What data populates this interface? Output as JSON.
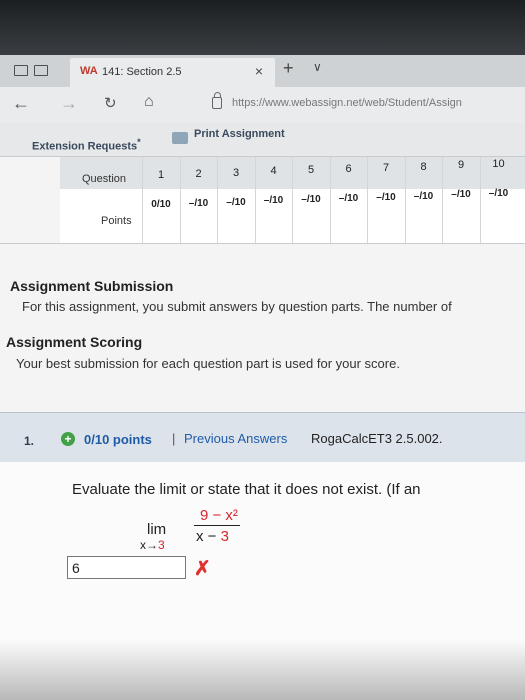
{
  "browser": {
    "tab_title": "141: Section 2.5",
    "tab_favicon": "WA",
    "tab_close": "×",
    "new_tab": "+",
    "tab_list": "∨",
    "url": "https://www.webassign.net/web/Student/Assign",
    "back": "←",
    "forward": "→",
    "refresh": "↻",
    "home": "⌂"
  },
  "toolbar": {
    "extension_requests": "Extension Requests",
    "extension_marker": "*",
    "print_assignment": "Print Assignment"
  },
  "score_grid": {
    "question_label": "Question",
    "points_label": "Points",
    "questions": [
      "1",
      "2",
      "3",
      "4",
      "5",
      "6",
      "7",
      "8",
      "9",
      "10"
    ],
    "scores": [
      "0/10",
      "–/10",
      "–/10",
      "–/10",
      "–/10",
      "–/10",
      "–/10",
      "–/10",
      "–/10",
      "–/10"
    ]
  },
  "submission": {
    "title": "Assignment Submission",
    "text": "For this assignment, you submit answers by question parts. The number of"
  },
  "scoring": {
    "title": "Assignment Scoring",
    "text": "Your best submission for each question part is used for your score."
  },
  "question": {
    "number": "1.",
    "plus": "+",
    "points": "0/10 points",
    "divider": "|",
    "previous_answers": "Previous Answers",
    "reference": "RogaCalcET3 2.5.002.",
    "prompt": "Evaluate the limit or state that it does not exist. (If an",
    "lim": "lim",
    "lim_sub_var": "x→",
    "lim_sub_val": "3",
    "numerator": "9 − x²",
    "denominator_var": "x − ",
    "denominator_val": "3",
    "answer": "6",
    "status_mark": "✗"
  },
  "colors": {
    "link": "#1f5ca8",
    "wrong": "#e0312f",
    "correct_badge": "#43a047"
  }
}
